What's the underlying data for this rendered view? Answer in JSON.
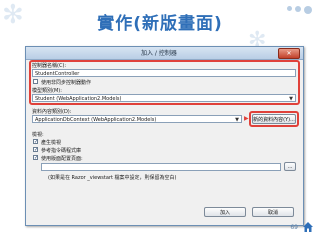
{
  "slide": {
    "title": "實作(新版畫面)",
    "page_number": "69",
    "colors": {
      "title": "#2f6fb8",
      "highlight": "#e0413a"
    }
  },
  "dialog": {
    "title": "加入 / 控制器",
    "controller_name_label": "控制器名稱(C):",
    "controller_name_value": "StudentController",
    "async_checkbox_label": "使用非同步控制器動作",
    "async_checked": false,
    "model_class_label": "模型類別(M):",
    "model_class_value": "Student (WebApplication2.Models)",
    "data_context_label": "資料內容類別(D):",
    "data_context_value": "ApplicationDbContext (WebApplication2.Models)",
    "new_data_context_button": "新的資料內容(Y)...",
    "views_label": "檢視:",
    "view_options": [
      {
        "label": "產生檢視",
        "checked": true
      },
      {
        "label": "參考指令碼程式庫",
        "checked": true
      },
      {
        "label": "使用版面配置頁面:",
        "checked": true
      }
    ],
    "layout_path_value": "",
    "browse_button": "...",
    "layout_hint": "(如果是在 Razor _viewstart 檔案中設定，則保留為空白)",
    "add_button": "加入",
    "cancel_button": "取消"
  }
}
